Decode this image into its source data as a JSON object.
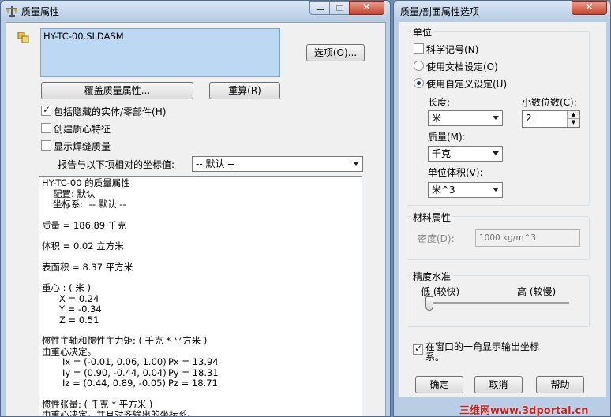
{
  "left_window": {
    "title": "质量属性",
    "file_name": "HY-TC-00.SLDASM",
    "options_btn": "选项(O)...",
    "override_btn": "覆盖质量属性...",
    "recalc_btn": "重算(R)",
    "include_hidden": "包括隐藏的实体/零部件(H)",
    "create_cm": "创建质心特征",
    "show_weld": "显示焊缝质量",
    "report_label": "报告与以下项相对的坐标值:",
    "coord_value": "-- 默认 --",
    "report": {
      "title": "HY-TC-00 的质量属性",
      "config": "配置: 默认",
      "coord": "坐标系:  -- 默认 --",
      "mass": "质量 = 186.89 千克",
      "volume": "体积 = 0.02 立方米",
      "area": "表面积 = 8.37 平方米",
      "cm_title": "重心 : ( 米 )",
      "cx": "X = 0.24",
      "cy": "Y = -0.34",
      "cz": "Z = 0.51",
      "axes_title": "惯性主轴和惯性主力矩: ( 千克 * 平方米 )",
      "axes_sub": "由重心决定。",
      "ix": "Ix = (-0.01, 0.06, 1.00)",
      "iy": "Iy = (0.90, -0.44, 0.04)",
      "iz": "Iz = (0.44, 0.89, -0.05)",
      "px": "Px = 13.94",
      "py": "Py = 18.31",
      "pz": "Pz = 18.71",
      "tensor_title": "惯性张量: ( 千克 * 平方米 )",
      "tensor_sub": "由重心决定，并且对齐输出的坐标系。"
    }
  },
  "right_window": {
    "title": "质量/剖面属性选项",
    "units_group": "单位",
    "sci": "科学记号(N)",
    "use_doc": "使用文档设定(O)",
    "use_custom": "使用自定义设定(U)",
    "length_label": "长度:",
    "length_value": "米",
    "decimals_label": "小数位数(C):",
    "decimals_value": "2",
    "mass_label": "质量(M):",
    "mass_value": "千克",
    "vol_label": "单位体积(V):",
    "vol_value": "米^3",
    "material_group": "材料属性",
    "density_label": "密度(D):",
    "density_value": "1000 kg/m^3",
    "accuracy_group": "精度水准",
    "low": "低 (较快)",
    "high": "高 (较慢)",
    "show_coord": "在窗口的一角显示输出坐标",
    "show_coord2": "系。",
    "ok": "确定",
    "cancel": "取消",
    "help": "帮助",
    "slider_value": 0.0
  },
  "watermark": "三维网www.3dportal.cn"
}
